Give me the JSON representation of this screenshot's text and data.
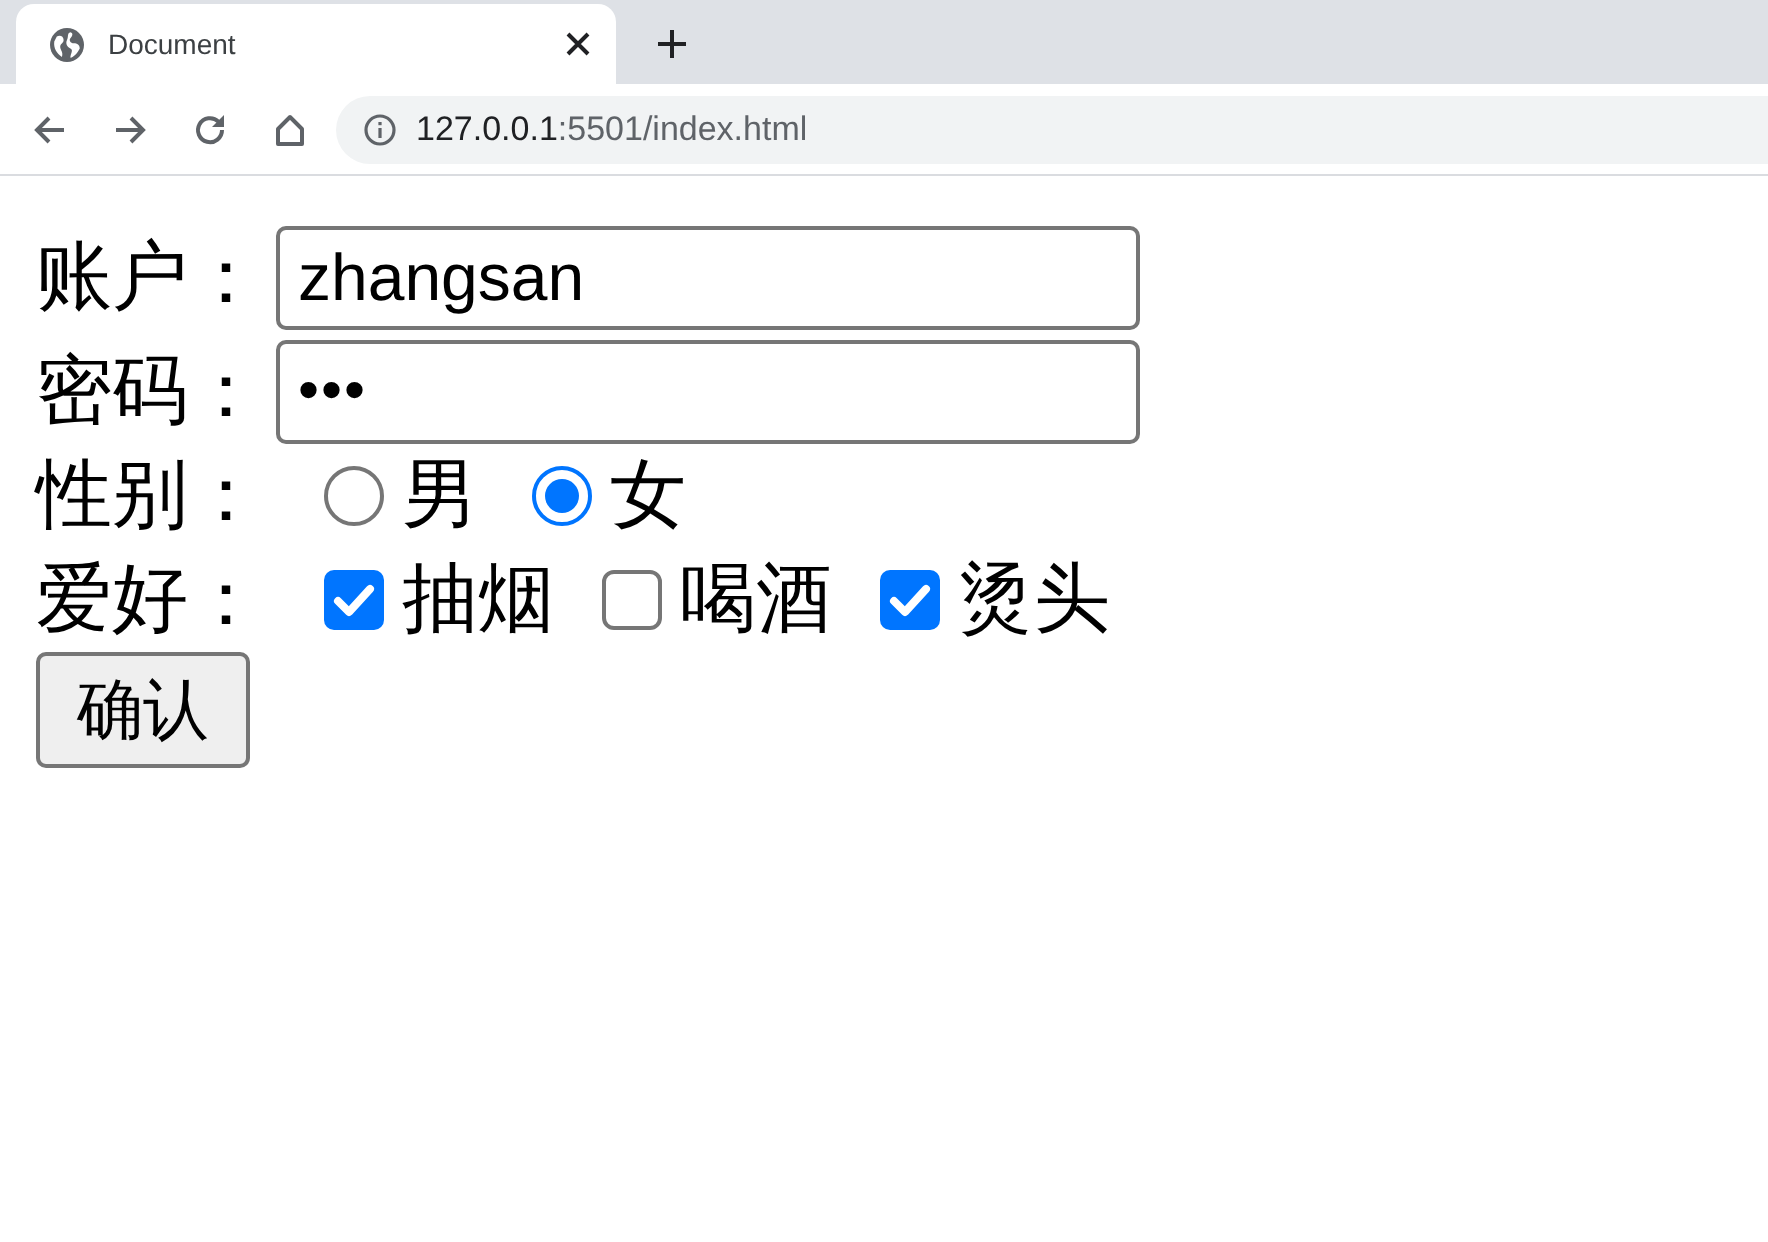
{
  "browser": {
    "tab": {
      "title": "Document"
    },
    "address": {
      "host": "127.0.0.1",
      "path": ":5501/index.html"
    }
  },
  "form": {
    "fields": [
      {
        "kind": "text",
        "label": "账户：",
        "value": "zhangsan"
      },
      {
        "kind": "password",
        "label": "密码：",
        "value": "•••"
      }
    ],
    "gender": {
      "label": "性别：",
      "options": [
        {
          "label": "男",
          "selected": false
        },
        {
          "label": "女",
          "selected": true
        }
      ]
    },
    "hobbies": {
      "label": "爱好：",
      "options": [
        {
          "label": "抽烟",
          "checked": true
        },
        {
          "label": "喝酒",
          "checked": false
        },
        {
          "label": "烫头",
          "checked": true
        }
      ]
    },
    "submit": "确认"
  }
}
